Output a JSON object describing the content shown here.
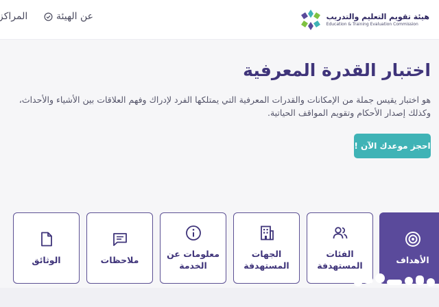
{
  "header": {
    "logo_ar": "هيئة تقويم التعليم والتدريب",
    "logo_en": "Education & Training Evaluation Commission",
    "nav": {
      "about": "عن الهيئة",
      "centers": "المراكز"
    }
  },
  "main": {
    "title": "اختبار القدرة المعرفية",
    "description": "هو اختبار يقيس جملة من الإمكانات والقدرات المعرفية التي يمتلكها الفرد لإدراك وفهم العلاقات بين الأشياء والأحداث، وكذلك إصدار الأحكام وتقويم المواقف الحياتية.",
    "book_button": "احجز موعدك الآن !"
  },
  "cards": [
    {
      "label": "الأهداف",
      "icon": "target-icon",
      "active": true
    },
    {
      "label": "الفئات المستهدفة",
      "icon": "users-icon",
      "active": false
    },
    {
      "label": "الجهات المستهدفة",
      "icon": "building-icon",
      "active": false
    },
    {
      "label": "معلومات عن الخدمة",
      "icon": "info-icon",
      "active": false
    },
    {
      "label": "ملاحظات",
      "icon": "comment-icon",
      "active": false
    },
    {
      "label": "الوثائق",
      "icon": "document-icon",
      "active": false
    }
  ],
  "colors": {
    "primary": "#5a4a9b",
    "accent": "#3fb3b6",
    "title": "#3f347a"
  }
}
